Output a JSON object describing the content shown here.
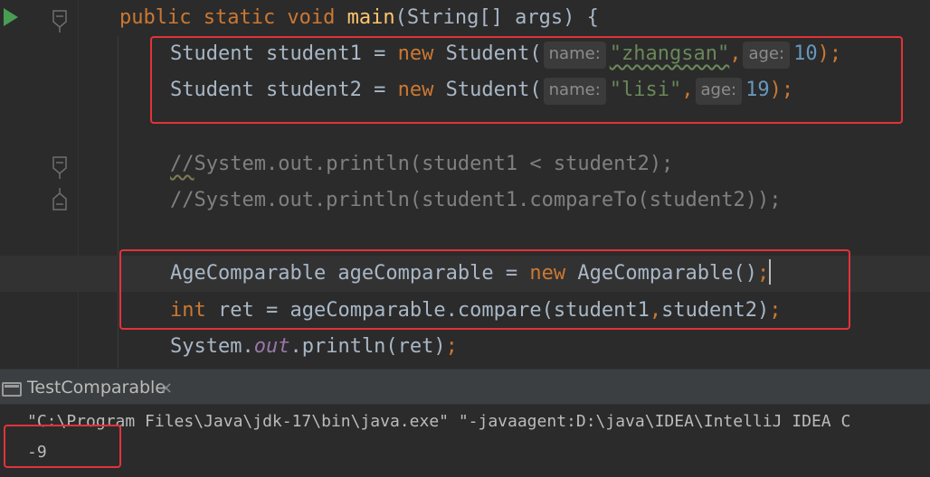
{
  "editor": {
    "line_main": {
      "kw": "public static void ",
      "name": "main",
      "rest": "(String[] args) {"
    },
    "line_s1": {
      "pre": "Student student1 = ",
      "kw_new": "new",
      "ctor": " Student(",
      "hint_name": "name:",
      "str": "\"zhangsan\"",
      "comma": ",",
      "hint_age": "age:",
      "num": "10",
      "end": ");"
    },
    "line_s2": {
      "pre": "Student student2 = ",
      "kw_new": "new",
      "ctor": " Student(",
      "hint_name": "name:",
      "str": "\"lisi\"",
      "comma": ",",
      "hint_age": "age:",
      "num": "19",
      "end": ");"
    },
    "comment1_slashes": "//",
    "comment1_rest": "System.out.println(student1 < student2);",
    "comment2": "//System.out.println(student1.compareTo(student2));",
    "line_cmp": {
      "pre": "AgeComparable ageComparable = ",
      "kw_new": "new",
      "rest": " AgeComparable()",
      "end": ";"
    },
    "line_ret": {
      "kw": "int",
      "mid": " ret = ageComparable.compare(student1",
      "comma": ",",
      "rest": "student2)",
      "end": ";"
    },
    "line_print": {
      "pre": "System.",
      "field": "out",
      "rest": ".println(ret)",
      "end": ";"
    }
  },
  "run_panel": {
    "tab_label": "TestComparable",
    "close_glyph": "×"
  },
  "console": {
    "command": "\"C:\\Program Files\\Java\\jdk-17\\bin\\java.exe\" \"-javaagent:D:\\java\\IDEA\\IntelliJ IDEA C",
    "output": "-9"
  },
  "colors": {
    "background": "#2b2b2b",
    "keyword": "#cc7832",
    "string": "#6a8759",
    "number": "#6897bb",
    "comment": "#808080",
    "function": "#ffc66d",
    "highlight_box": "#e3323a"
  }
}
